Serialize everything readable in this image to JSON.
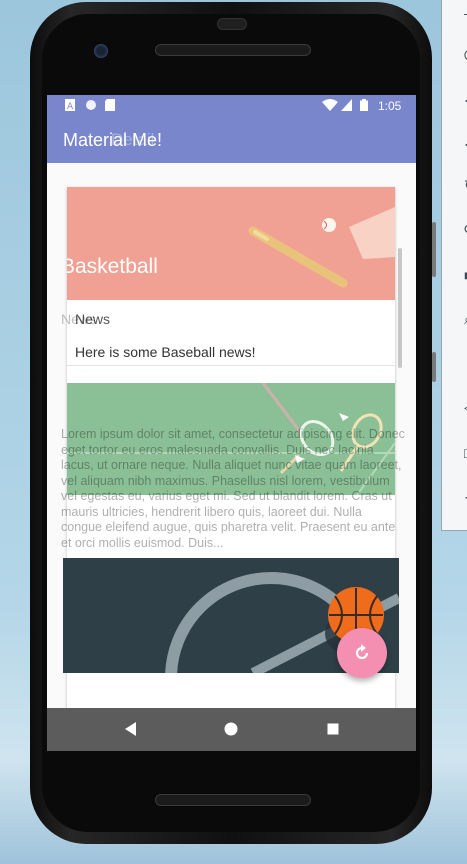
{
  "status_bar": {
    "time": "1:05"
  },
  "app_bar": {
    "title": "Material Me!",
    "ghost_title": "Detail"
  },
  "card": {
    "title": "Basketball",
    "category": "News",
    "ghost_category": "News",
    "subtitle": "Here is some Baseball news!"
  },
  "overlay_text": "Lorem ipsum dolor sit amet, consectetur adipiscing elit. Donec eget tortor eu eros malesuada convallis. Duis nec lacinia lacus, ut ornare neque. Nulla aliquet nunc vitae quam laoreet, vel aliquam nibh maximus. Phasellus nisl lorem, vestibulum vel egestas eu, varius eget mi. Sed ut blandit lorem. Cras ut mauris ultricies, hendrerit libero quis, laoreet dui. Nulla congue eleifend augue, quis pharetra velit. Praesent eu ante et orci mollis euismod. Duis...",
  "icons": {
    "fab": "refresh-icon",
    "nav_back": "back-triangle-icon",
    "nav_home": "home-circle-icon",
    "nav_recents": "recents-square-icon"
  },
  "colors": {
    "primary": "#7986cb",
    "accent": "#f48fb1"
  }
}
